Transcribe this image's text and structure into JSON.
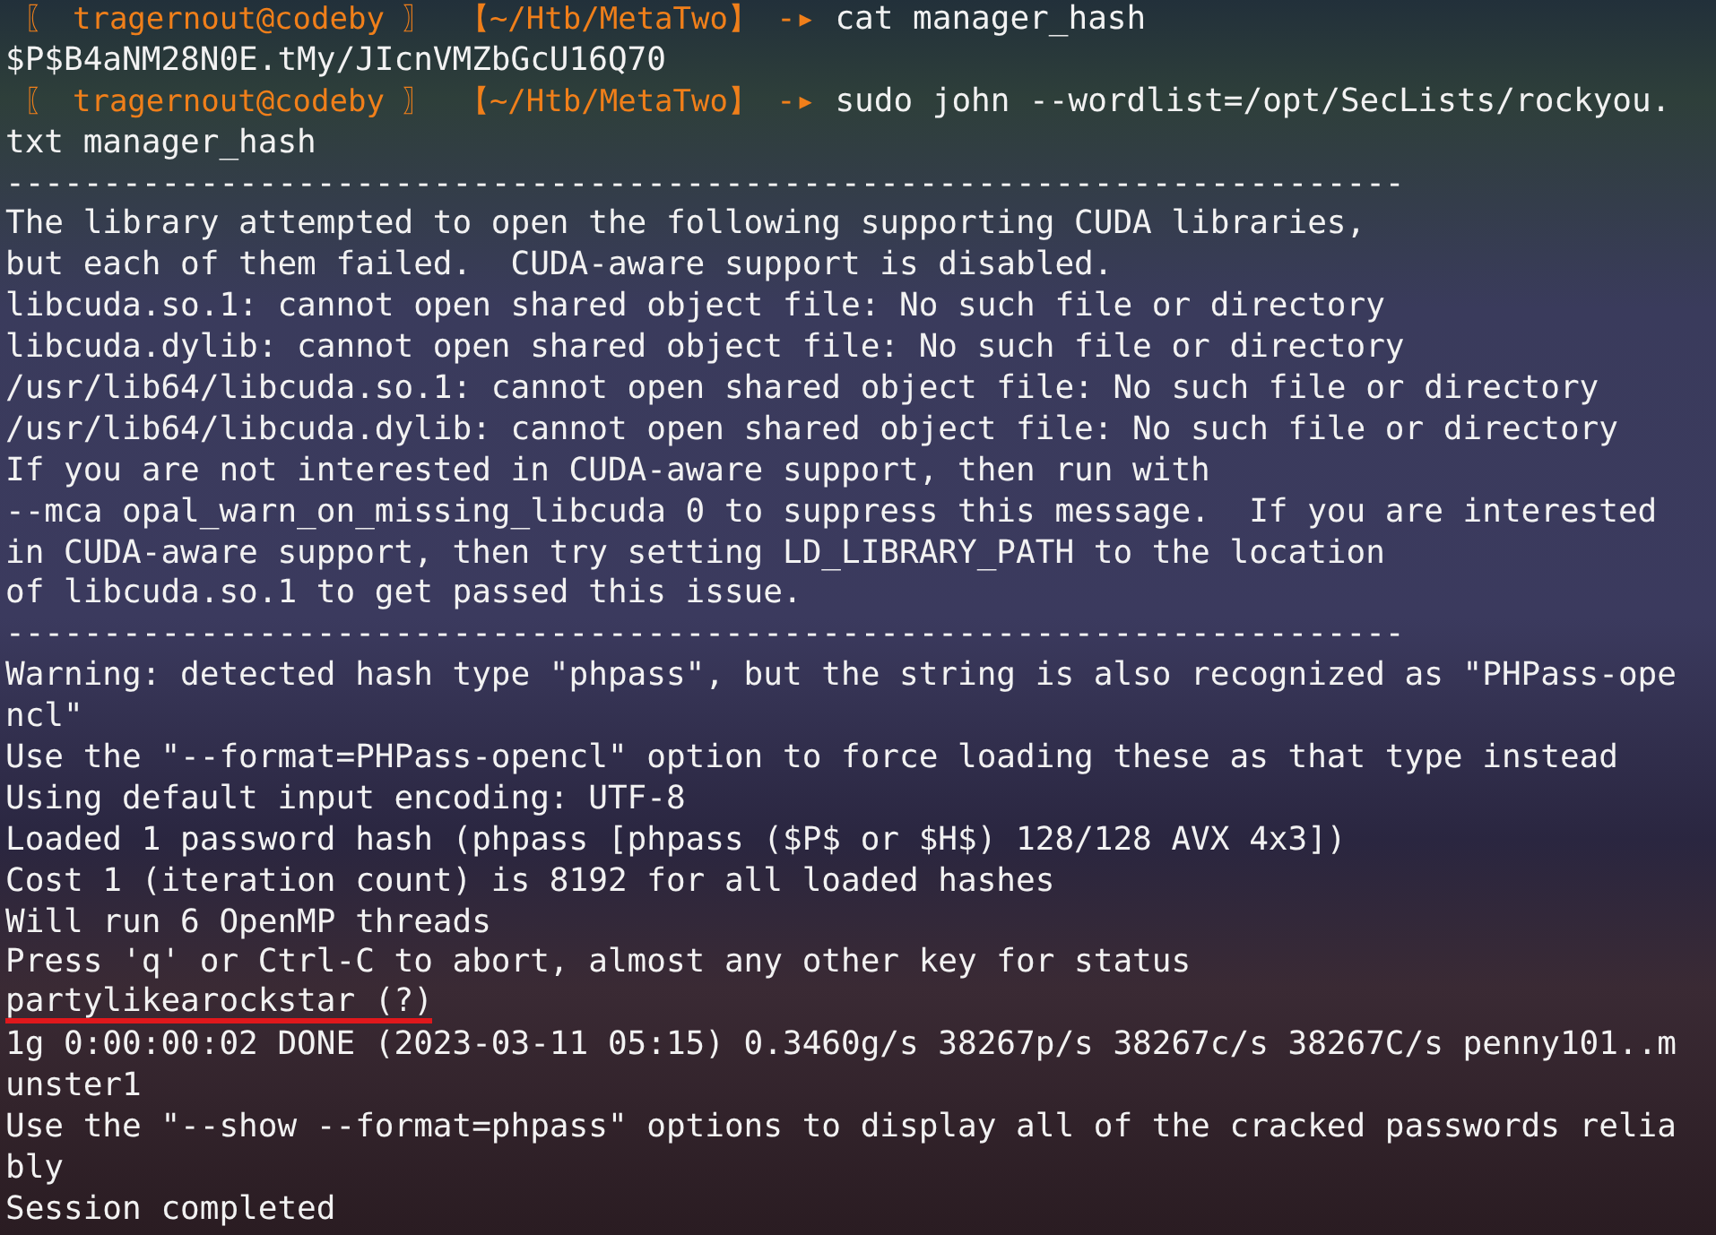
{
  "terminal": {
    "lines": [
      {
        "kind": "prompt",
        "user": "〖 tragernout@codeby 〗",
        "path": "【~/Htb/MetaTwo】",
        "arrow": "-▸",
        "command": "cat manager_hash"
      },
      {
        "kind": "output",
        "text": "$P$B4aNM28N0E.tMy/JIcnVMZbGcU16Q70",
        "underlined": false
      },
      {
        "kind": "prompt",
        "user": "〖 tragernout@codeby 〗",
        "path": "【~/Htb/MetaTwo】",
        "arrow": "-▸",
        "command": "sudo john --wordlist=/opt/SecLists/rockyou."
      },
      {
        "kind": "output",
        "text": "txt manager_hash",
        "underlined": false
      },
      {
        "kind": "output",
        "text": "------------------------------------------------------------------------",
        "underlined": false
      },
      {
        "kind": "output",
        "text": "The library attempted to open the following supporting CUDA libraries,",
        "underlined": false
      },
      {
        "kind": "output",
        "text": "but each of them failed.  CUDA-aware support is disabled.",
        "underlined": false
      },
      {
        "kind": "output",
        "text": "libcuda.so.1: cannot open shared object file: No such file or directory",
        "underlined": false
      },
      {
        "kind": "output",
        "text": "libcuda.dylib: cannot open shared object file: No such file or directory",
        "underlined": false
      },
      {
        "kind": "output",
        "text": "/usr/lib64/libcuda.so.1: cannot open shared object file: No such file or directory",
        "underlined": false
      },
      {
        "kind": "output",
        "text": "/usr/lib64/libcuda.dylib: cannot open shared object file: No such file or directory",
        "underlined": false
      },
      {
        "kind": "output",
        "text": "If you are not interested in CUDA-aware support, then run with",
        "underlined": false
      },
      {
        "kind": "output",
        "text": "--mca opal_warn_on_missing_libcuda 0 to suppress this message.  If you are interested",
        "underlined": false
      },
      {
        "kind": "output",
        "text": "in CUDA-aware support, then try setting LD_LIBRARY_PATH to the location",
        "underlined": false
      },
      {
        "kind": "output",
        "text": "of libcuda.so.1 to get passed this issue.",
        "underlined": false
      },
      {
        "kind": "output",
        "text": "------------------------------------------------------------------------",
        "underlined": false
      },
      {
        "kind": "output",
        "text": "Warning: detected hash type \"phpass\", but the string is also recognized as \"PHPass-ope",
        "underlined": false
      },
      {
        "kind": "output",
        "text": "ncl\"",
        "underlined": false
      },
      {
        "kind": "output",
        "text": "Use the \"--format=PHPass-opencl\" option to force loading these as that type instead",
        "underlined": false
      },
      {
        "kind": "output",
        "text": "Using default input encoding: UTF-8",
        "underlined": false
      },
      {
        "kind": "output",
        "text": "Loaded 1 password hash (phpass [phpass ($P$ or $H$) 128/128 AVX 4x3])",
        "underlined": false
      },
      {
        "kind": "output",
        "text": "Cost 1 (iteration count) is 8192 for all loaded hashes",
        "underlined": false
      },
      {
        "kind": "output",
        "text": "Will run 6 OpenMP threads",
        "underlined": false
      },
      {
        "kind": "output",
        "text": "Press 'q' or Ctrl-C to abort, almost any other key for status",
        "underlined": false
      },
      {
        "kind": "output",
        "text": "partylikearockstar (?)",
        "underlined": true
      },
      {
        "kind": "output",
        "text": "1g 0:00:00:02 DONE (2023-03-11 05:15) 0.3460g/s 38267p/s 38267c/s 38267C/s penny101..m",
        "underlined": false
      },
      {
        "kind": "output",
        "text": "unster1",
        "underlined": false
      },
      {
        "kind": "output",
        "text": "Use the \"--show --format=phpass\" options to display all of the cracked passwords relia",
        "underlined": false
      },
      {
        "kind": "output",
        "text": "bly",
        "underlined": false
      },
      {
        "kind": "output",
        "text": "Session completed",
        "underlined": false
      }
    ]
  }
}
